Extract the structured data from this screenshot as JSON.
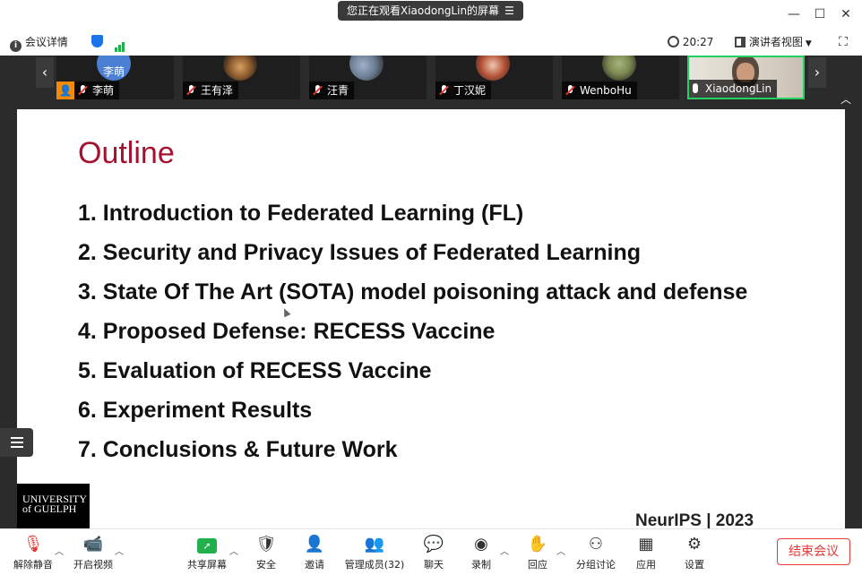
{
  "titlebar": {
    "share_banner": "您正在观看XiaodongLin的屏幕",
    "menu_icon": "menu-icon"
  },
  "infobar": {
    "meeting_details": "会议详情",
    "time": "20:27",
    "view_mode": "演讲者视图"
  },
  "participants": [
    {
      "name": "李萌",
      "avatar_text": "李萌",
      "avatar_color": "#4a7fd4"
    },
    {
      "name": "王有泽",
      "avatar_color": "#8a5a2e"
    },
    {
      "name": "汪青",
      "avatar_color": "#6b7d92"
    },
    {
      "name": "丁汉妮",
      "avatar_color": "#b5553a"
    },
    {
      "name": "WenboHu",
      "avatar_color": "#7a8a52"
    },
    {
      "name": "XiaodongLin",
      "avatar_color": "#c9c0b2"
    }
  ],
  "slide": {
    "title": "Outline",
    "items": [
      "1. Introduction to Federated Learning (FL)",
      "2. Security and Privacy Issues of Federated Learning",
      "3. State Of The Art (SOTA) model poisoning attack and defense",
      "4. Proposed Defense: RECESS Vaccine",
      "5. Evaluation of RECESS Vaccine",
      "6. Experiment Results",
      "7. Conclusions & Future Work"
    ],
    "logo_line1": "UNIVERSITY",
    "logo_line2": "of GUELPH",
    "footer": "NeurIPS | 2023"
  },
  "toolbar": {
    "unmute": "解除静音",
    "start_video": "开启视频",
    "share_screen": "共享屏幕",
    "security": "安全",
    "invite": "邀请",
    "manage_participants": "管理成员(32)",
    "chat": "聊天",
    "record": "录制",
    "reactions": "回应",
    "breakout": "分组讨论",
    "apps": "应用",
    "settings": "设置",
    "end_meeting": "结束会议"
  },
  "colors": {
    "slide_title": "#a6112f",
    "accent_green": "#21b04b",
    "end_red": "#e53935"
  }
}
